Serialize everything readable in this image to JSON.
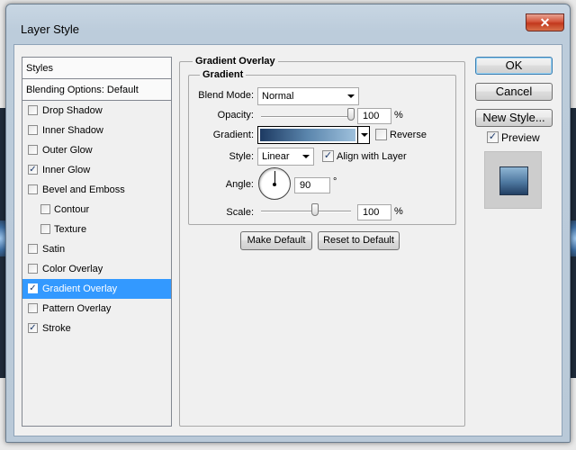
{
  "window": {
    "title": "Layer Style",
    "close_glyph": "✕"
  },
  "styles_panel": {
    "header": "Styles",
    "blending": "Blending Options: Default",
    "items": [
      {
        "label": "Drop Shadow",
        "checked": false,
        "indent": false
      },
      {
        "label": "Inner Shadow",
        "checked": false,
        "indent": false
      },
      {
        "label": "Outer Glow",
        "checked": false,
        "indent": false
      },
      {
        "label": "Inner Glow",
        "checked": true,
        "indent": false
      },
      {
        "label": "Bevel and Emboss",
        "checked": false,
        "indent": false
      },
      {
        "label": "Contour",
        "checked": false,
        "indent": true
      },
      {
        "label": "Texture",
        "checked": false,
        "indent": true
      },
      {
        "label": "Satin",
        "checked": false,
        "indent": false
      },
      {
        "label": "Color Overlay",
        "checked": false,
        "indent": false
      },
      {
        "label": "Gradient Overlay",
        "checked": true,
        "indent": false,
        "selected": true
      },
      {
        "label": "Pattern Overlay",
        "checked": false,
        "indent": false
      },
      {
        "label": "Stroke",
        "checked": true,
        "indent": false
      }
    ]
  },
  "gradient_overlay": {
    "section_title": "Gradient Overlay",
    "group_title": "Gradient",
    "blend_mode": {
      "label": "Blend Mode:",
      "value": "Normal"
    },
    "opacity": {
      "label": "Opacity:",
      "value": "100",
      "unit": "%",
      "fraction": 1.0
    },
    "gradient": {
      "label": "Gradient:",
      "colors": [
        "#1d3a62",
        "#5b86ad",
        "#9ec0dc"
      ]
    },
    "reverse": {
      "label": "Reverse",
      "checked": false
    },
    "style": {
      "label": "Style:",
      "value": "Linear"
    },
    "align_with_layer": {
      "label": "Align with Layer",
      "checked": true
    },
    "angle": {
      "label": "Angle:",
      "value": "90",
      "unit": "°"
    },
    "scale": {
      "label": "Scale:",
      "value": "100",
      "unit": "%",
      "fraction": 0.6
    },
    "make_default": "Make Default",
    "reset_to_default": "Reset to Default"
  },
  "actions": {
    "ok": "OK",
    "cancel": "Cancel",
    "new_style": "New Style...",
    "preview": {
      "label": "Preview",
      "checked": true
    }
  },
  "check_glyph": "✓",
  "colors": {
    "selection": "#3399ff",
    "window_frame": "#b9c9d8",
    "close_button": "#c2381c"
  }
}
